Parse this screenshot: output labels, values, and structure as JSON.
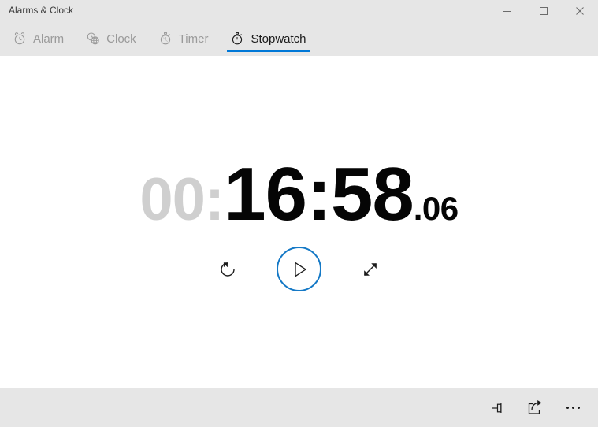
{
  "window": {
    "title": "Alarms & Clock",
    "controls": {
      "minimize": "minimize-button",
      "maximize": "maximize-button",
      "close": "close-button"
    },
    "colors": {
      "chrome": "#e6e6e6",
      "content": "#ffffff",
      "accent": "#0078d7",
      "play_ring": "#1579c6",
      "dim_text": "#cfcfcf",
      "primary_text": "#1b1b1b",
      "inactive_tab_text": "#9a9a9a"
    }
  },
  "tabs": [
    {
      "label": "Alarm",
      "icon": "alarm-clock-icon",
      "active": false
    },
    {
      "label": "Clock",
      "icon": "world-clock-icon",
      "active": false
    },
    {
      "label": "Timer",
      "icon": "timer-icon",
      "active": false
    },
    {
      "label": "Stopwatch",
      "icon": "stopwatch-icon",
      "active": true
    }
  ],
  "stopwatch": {
    "hours_minutes_dim": "00:",
    "elapsed_main": "16:58",
    "elapsed_fraction": ".06",
    "full_readout": "00:16:58.06",
    "state": "stopped",
    "controls": {
      "reset": {
        "label": "Reset",
        "icon": "reset-icon"
      },
      "start": {
        "label": "Start",
        "icon": "play-icon"
      },
      "expand": {
        "label": "Expand",
        "icon": "expand-diagonal-icon"
      }
    }
  },
  "commandbar": {
    "items": [
      {
        "label": "Pin",
        "icon": "pin-icon"
      },
      {
        "label": "Share",
        "icon": "share-icon"
      },
      {
        "label": "See more",
        "icon": "more-ellipsis-icon"
      }
    ]
  }
}
